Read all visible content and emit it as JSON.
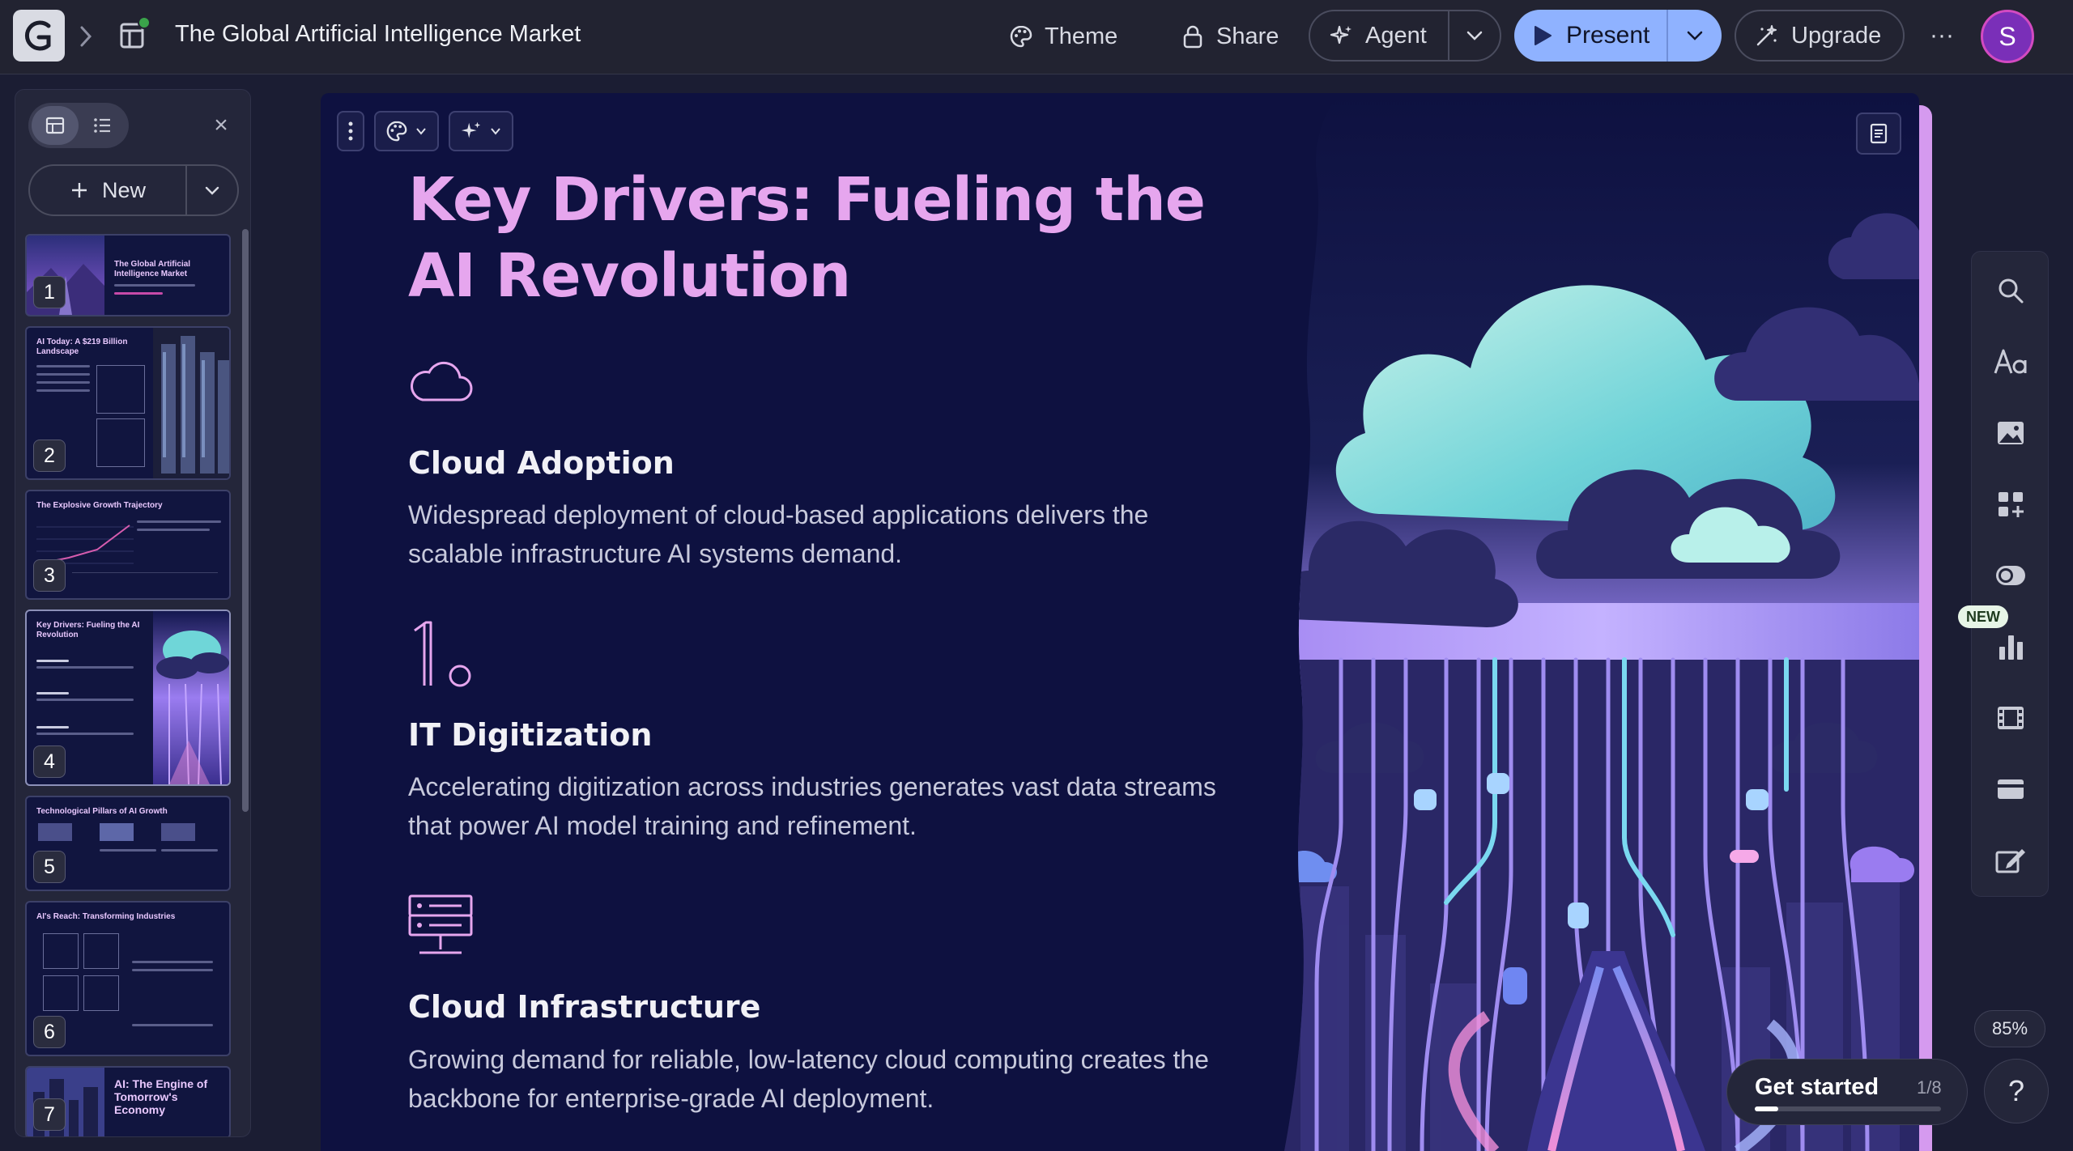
{
  "app": {
    "logo_letter": "G",
    "document_title": "The Global Artificial Intelligence Market"
  },
  "toolbar": {
    "theme_label": "Theme",
    "share_label": "Share",
    "agent_label": "Agent",
    "present_label": "Present",
    "upgrade_label": "Upgrade",
    "more_label": "···",
    "avatar_initial": "S",
    "accent_present": "#8fb2ff"
  },
  "panel": {
    "new_label": "New",
    "close_label": "×",
    "thumbnails": [
      {
        "number": "1",
        "title": "The Global Artificial Intelligence Market"
      },
      {
        "number": "2",
        "title": "AI Today: A $219 Billion Landscape"
      },
      {
        "number": "3",
        "title": "The Explosive Growth Trajectory"
      },
      {
        "number": "4",
        "title": "Key Drivers: Fueling the AI Revolution"
      },
      {
        "number": "5",
        "title": "Technological Pillars of AI Growth"
      },
      {
        "number": "6",
        "title": "AI's Reach: Transforming Industries"
      },
      {
        "number": "7",
        "title": "AI: The Engine of Tomorrow's Economy"
      }
    ]
  },
  "slide": {
    "title": "Key Drivers: Fueling the AI Revolution",
    "title_color": "#e6a6ee",
    "background": "#0e1140",
    "features": [
      {
        "icon": "cloud-icon",
        "heading": "Cloud Adoption",
        "body": "Widespread deployment of cloud-based applications delivers the scalable infrastructure AI systems demand."
      },
      {
        "icon": "number-one-icon",
        "heading": "IT Digitization",
        "body": "Accelerating digitization across industries generates vast data streams that power AI model training and refinement."
      },
      {
        "icon": "server-icon",
        "heading": "Cloud Infrastructure",
        "body": "Growing demand for reliable, low-latency cloud computing creates the backbone for enterprise-grade AI deployment."
      }
    ]
  },
  "right_tools": {
    "new_badge": "NEW",
    "zoom_level": "85%",
    "get_started_label": "Get started",
    "get_started_count": "1/8",
    "get_started_progress": 0.125,
    "help_label": "?"
  }
}
